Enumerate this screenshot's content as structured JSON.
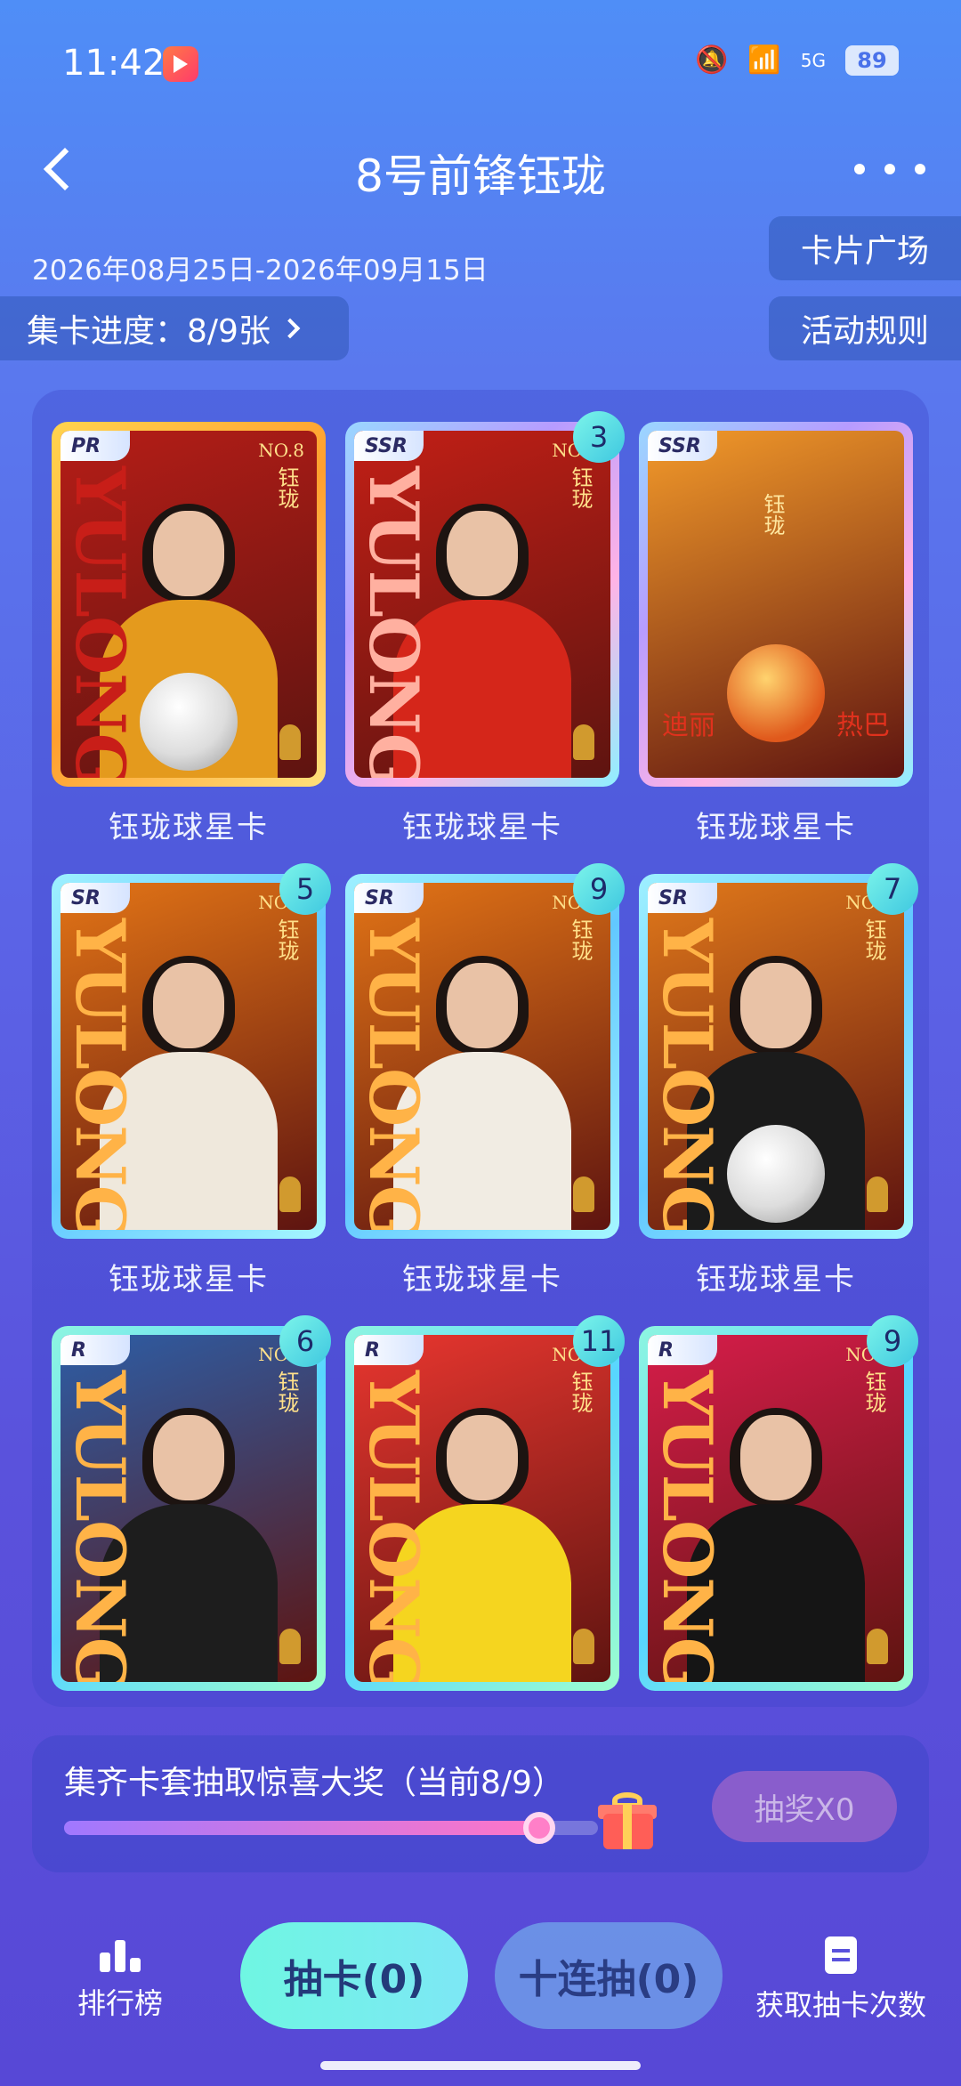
{
  "status_bar": {
    "time": "11:42",
    "network": "5G",
    "battery": "89"
  },
  "header": {
    "title": "8号前锋钰珑"
  },
  "date_range": "2026年08月25日-2026年09月15日",
  "buttons": {
    "card_plaza": "卡片广场",
    "activity_rules": "活动规则",
    "progress": "集卡进度：8/9张"
  },
  "cards": [
    {
      "rarity": "PR",
      "name": "钰珑球星卡",
      "count": "",
      "tier": "pr",
      "outfit_color": "#e49a1d",
      "bg_color": "#b51d17"
    },
    {
      "rarity": "SSR",
      "name": "钰珑球星卡",
      "count": "3",
      "tier": "ssr",
      "outfit_color": "#d5261a",
      "bg_color": "#c21f16"
    },
    {
      "rarity": "SSR",
      "name": "钰珑球星卡",
      "count": "",
      "tier": "ssr",
      "outfit_color": "#f2a13b",
      "bg_color": "#f39a2a"
    },
    {
      "rarity": "SR",
      "name": "钰珑球星卡",
      "count": "5",
      "tier": "sr",
      "outfit_color": "#efe8dc",
      "bg_color": "#e27416"
    },
    {
      "rarity": "SR",
      "name": "钰珑球星卡",
      "count": "9",
      "tier": "sr",
      "outfit_color": "#f1ece3",
      "bg_color": "#e27416"
    },
    {
      "rarity": "SR",
      "name": "钰珑球星卡",
      "count": "7",
      "tier": "sr",
      "outfit_color": "#1b1b1b",
      "bg_color": "#e0781a"
    },
    {
      "rarity": "R",
      "name": "",
      "count": "6",
      "tier": "r",
      "outfit_color": "#1d1d1d",
      "bg_color": "#2d5da5"
    },
    {
      "rarity": "R",
      "name": "",
      "count": "11",
      "tier": "r",
      "outfit_color": "#f5d51f",
      "bg_color": "#e8362f"
    },
    {
      "rarity": "R",
      "name": "",
      "count": "9",
      "tier": "r",
      "outfit_color": "#151515",
      "bg_color": "#d61d4a"
    }
  ],
  "card_art": {
    "yulong": "YULONG",
    "name_vertical": "钰珑",
    "number": "NO.8",
    "left_char": "迪丽",
    "right_char": "热巴"
  },
  "prize": {
    "text": "集齐卡套抽取惊喜大奖（当前8/9）",
    "progress": 0.89,
    "draw_label": "抽奖X0"
  },
  "bottom_bar": {
    "rank_label": "排行榜",
    "draw_label": "抽卡(0)",
    "ten_draw_label": "十连抽(0)",
    "get_times_label": "获取抽卡次数"
  }
}
